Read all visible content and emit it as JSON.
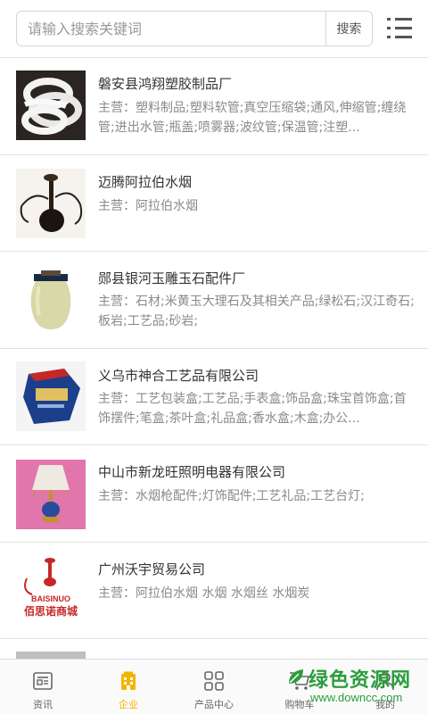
{
  "search": {
    "placeholder": "请输入搜索关键词",
    "value": "",
    "button_label": "搜索"
  },
  "companies": [
    {
      "name": "磐安县鸿翔塑胶制品厂",
      "desc": "主营：塑料制品;塑料软管;真空压缩袋;通风,伸缩管;缠绕管;进出水管;瓶盖;喷雾器;波纹管;保温管;注塑..."
    },
    {
      "name": "迈腾阿拉伯水烟",
      "desc": "主营：阿拉伯水烟"
    },
    {
      "name": "郧县银河玉雕玉石配件厂",
      "desc": "主营：石材;米黄玉大理石及其相关产品;绿松石;汉江奇石;板岩;工艺品;砂岩;"
    },
    {
      "name": "义乌市神合工艺品有限公司",
      "desc": "主营：工艺包装盒;工艺品;手表盒;饰品盒;珠宝首饰盒;首饰摆件;笔盒;茶叶盒;礼品盒;香水盒;木盒;办公..."
    },
    {
      "name": "中山市新龙旺照明电器有限公司",
      "desc": "主营：水烟枪配件;灯饰配件;工艺礼品;工艺台灯;"
    },
    {
      "name": "广州沃宇贸易公司",
      "desc": "主营：阿拉伯水烟 水烟 水烟丝 水烟炭",
      "logo_text_en": "BAISINUO",
      "logo_text_cn": "佰思诺商城"
    }
  ],
  "tabs": [
    {
      "label": "资讯",
      "icon": "news-icon",
      "active": false
    },
    {
      "label": "企业",
      "icon": "company-icon",
      "active": true
    },
    {
      "label": "产品中心",
      "icon": "grid-icon",
      "active": false
    },
    {
      "label": "购物车",
      "icon": "cart-icon",
      "active": false
    },
    {
      "label": "我的",
      "icon": "user-icon",
      "active": false
    }
  ],
  "watermark": {
    "title": "绿色资源网",
    "url": "www.downcc.com"
  },
  "colors": {
    "active_tab": "#f5b400",
    "text": "#333333",
    "muted": "#8a8a8a",
    "divider": "#e2e2e2",
    "watermark": "#2a9d3c"
  }
}
